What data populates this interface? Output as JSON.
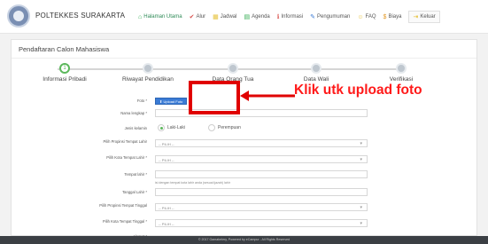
{
  "brand": {
    "name": "POLTEKKES SURAKARTA"
  },
  "nav": [
    {
      "label": "Halaman Utama",
      "icon": "home-icon",
      "glyph": "⌂",
      "color": "green"
    },
    {
      "label": "Alur",
      "icon": "check-icon",
      "glyph": "✔",
      "color": "red"
    },
    {
      "label": "Jadwal",
      "icon": "calendar-icon",
      "glyph": "▦",
      "color": "yellow"
    },
    {
      "label": "Agenda",
      "icon": "agenda-icon",
      "glyph": "▤",
      "color": "green"
    },
    {
      "label": "Informasi",
      "icon": "info-icon",
      "glyph": "ℹ",
      "color": "red"
    },
    {
      "label": "Pengumuman",
      "icon": "megaphone-icon",
      "glyph": "✎",
      "color": "blue"
    },
    {
      "label": "FAQ",
      "icon": "question-icon",
      "glyph": "☺",
      "color": "yellow"
    },
    {
      "label": "Biaya",
      "icon": "dollar-icon",
      "glyph": "$",
      "color": "orange"
    },
    {
      "label": "Keluar",
      "icon": "logout-icon",
      "glyph": "⇥",
      "color": "yellow"
    }
  ],
  "page": {
    "title": "Pendaftaran Calon Mahasiswa"
  },
  "steps": [
    {
      "label": "Informasi Pribadi",
      "active": true,
      "num": "1"
    },
    {
      "label": "Riwayat Pendidikan",
      "active": false,
      "num": ""
    },
    {
      "label": "Data Orang Tua",
      "active": false,
      "num": ""
    },
    {
      "label": "Data Wali",
      "active": false,
      "num": ""
    },
    {
      "label": "Verifikasi",
      "active": false,
      "num": ""
    }
  ],
  "form": {
    "foto_label": "Foto *",
    "upload_label": "⬆ Upload Foto",
    "nama_label": "Nama lengkap *",
    "jk_label": "Jenis kelamin",
    "jk_options": [
      "Laki-Laki",
      "Perempuan"
    ],
    "prov_lahir_label": "Pilih Propinsi Tempat Lahir",
    "prov_lahir_value": "-- PILIH --",
    "kota_lahir_label": "Pilih Kota Tempat Lahir *",
    "kota_lahir_value": "-- PILIH --",
    "tempat_lahir_label": "Tempat lahir *",
    "tempat_lahir_hint": "isi dengan tempat kota lahir anda (sesuai ijazah) lahir",
    "tgl_lahir_label": "Tanggal Lahir *",
    "prov_tinggal_label": "Pilih Propinsi Tempat Tinggal",
    "prov_tinggal_value": "-- PILIH --",
    "kota_tinggal_label": "Pilih Kota Tempat Tinggal *",
    "kota_tinggal_value": "-- PILIH --",
    "alamat_label": "Alamat *"
  },
  "annotation": {
    "text": "Klik utk upload foto",
    "color": "#ff1a1a"
  },
  "footer": {
    "text": "© 2017 Gamabelery, Powered by eCampur - All Rights Reserved"
  }
}
